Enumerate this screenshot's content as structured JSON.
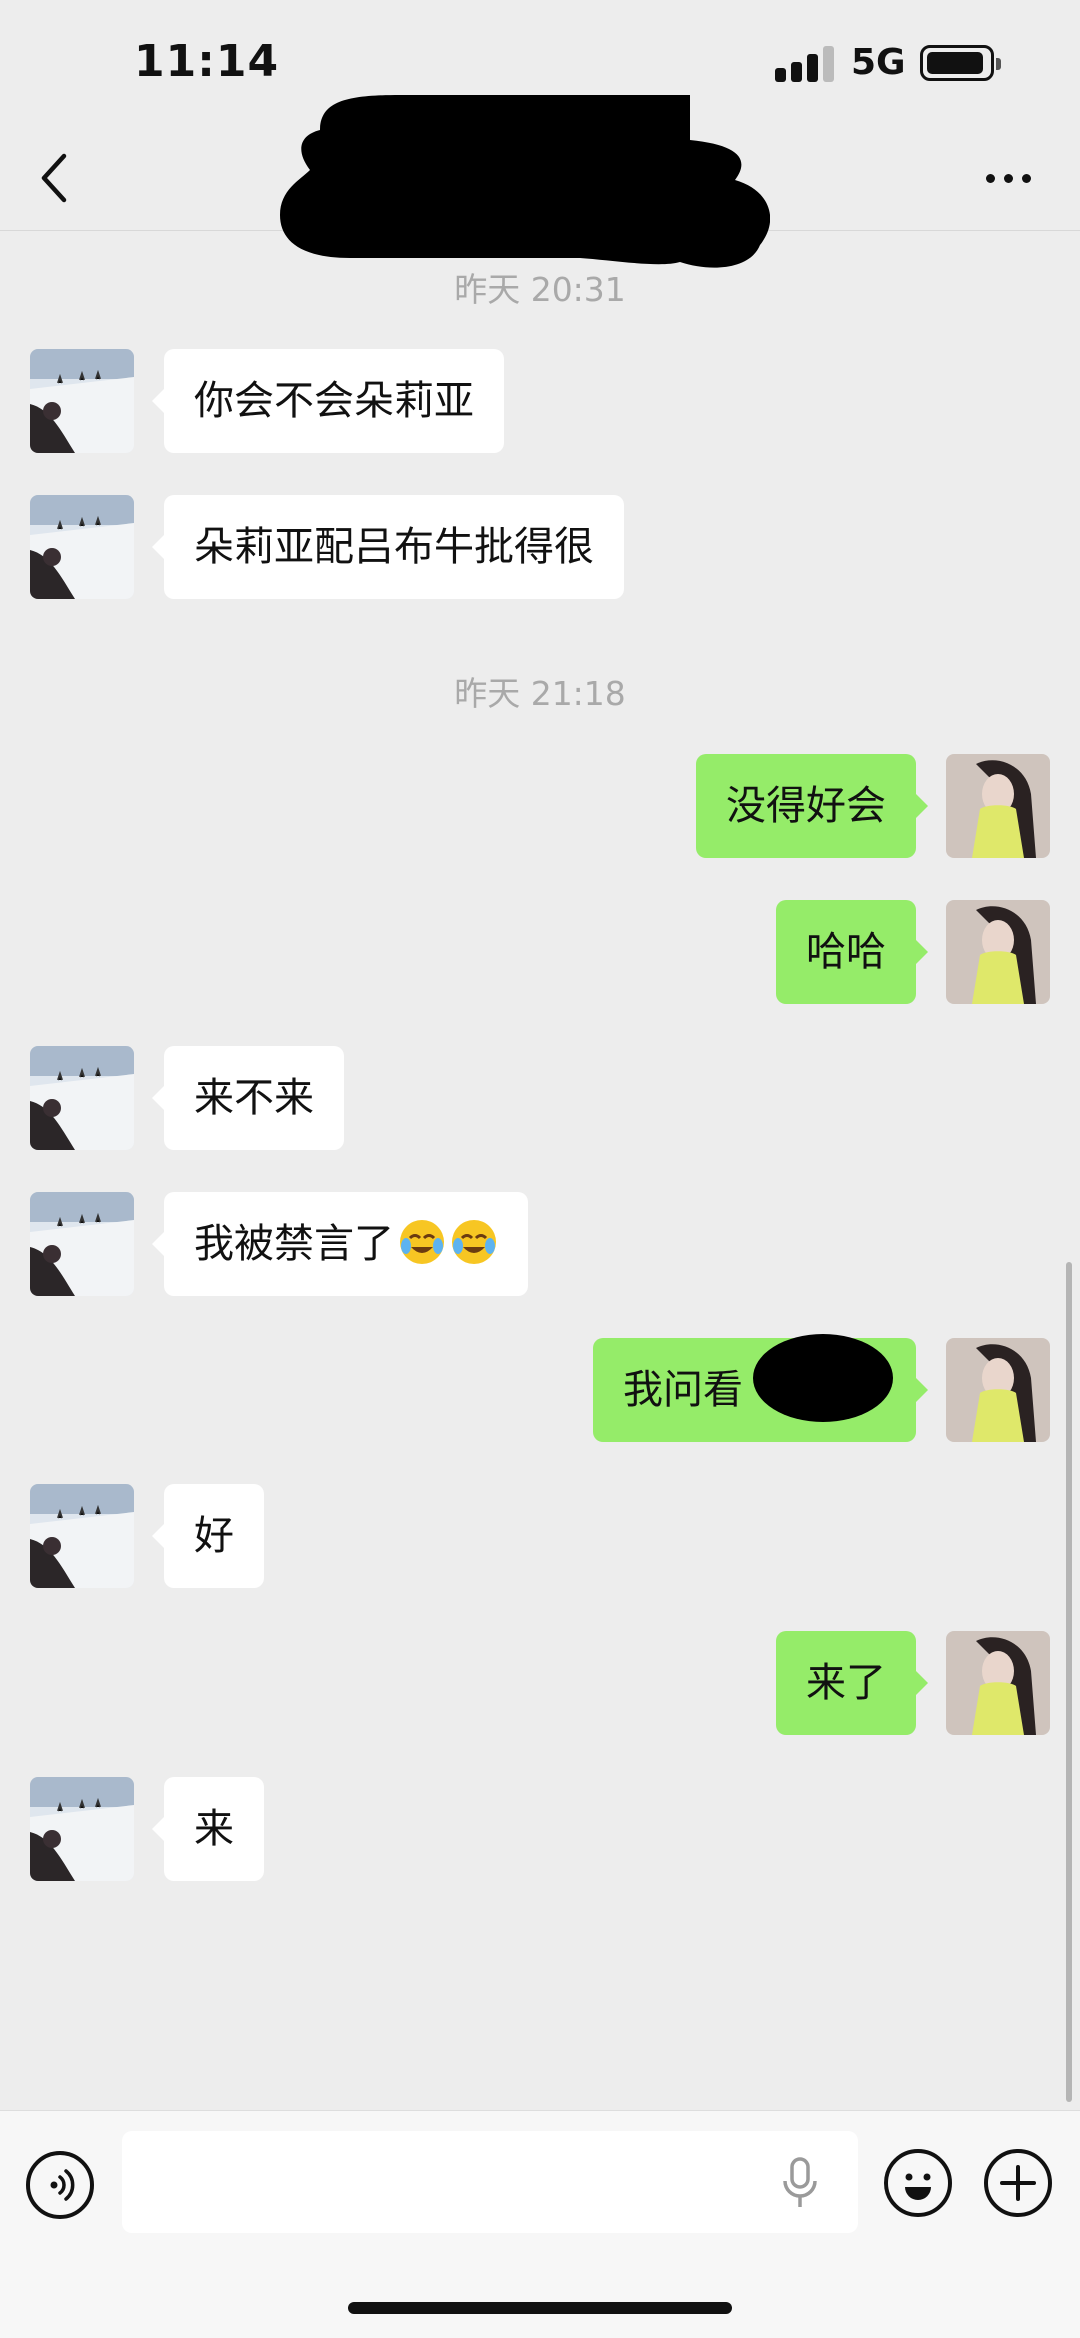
{
  "status_bar": {
    "time": "11:14",
    "network": "5G"
  },
  "navbar": {
    "back_icon": "chevron-left-icon",
    "more_icon": "ellipsis-icon"
  },
  "messages": [
    {
      "timestamp": "昨天 20:31"
    },
    {
      "dir": "in",
      "text": "你会不会朵莉亚"
    },
    {
      "dir": "in",
      "text": "朵莉亚配吕布牛批得很"
    },
    {
      "timestamp": "昨天 21:18"
    },
    {
      "dir": "out",
      "text": "没得好会"
    },
    {
      "dir": "out",
      "text": "哈哈"
    },
    {
      "dir": "in",
      "text": "来不来"
    },
    {
      "dir": "in",
      "text": "我被禁言了",
      "emoji": "crying-laughing-emoji"
    },
    {
      "dir": "out",
      "text": "我问看"
    },
    {
      "dir": "in",
      "text": "好"
    },
    {
      "dir": "out",
      "text": "来了"
    },
    {
      "dir": "in",
      "text": "来"
    }
  ],
  "input": {
    "placeholder": ""
  },
  "colors": {
    "background": "#ededed",
    "outgoing_bubble": "#95ec69",
    "incoming_bubble": "#ffffff"
  }
}
